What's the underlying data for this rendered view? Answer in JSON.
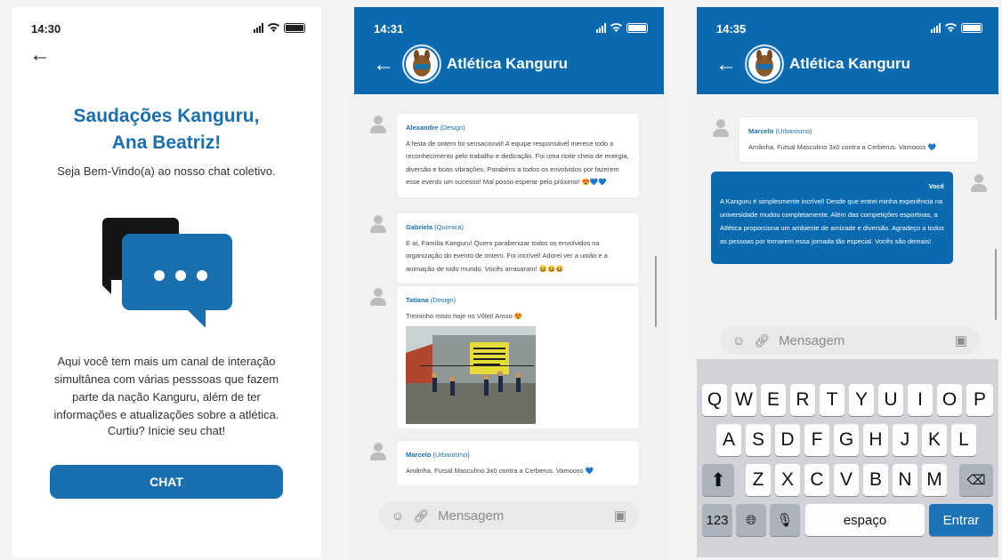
{
  "screen1": {
    "time": "14:30",
    "greeting_line1": "Saudações Kanguru,",
    "greeting_line2": "Ana Beatriz!",
    "welcome": "Seja Bem-Vindo(a) ao nosso chat coletivo.",
    "info": "Aqui você tem mais um canal de interação simultânea com várias pesssoas que fazem parte da nação Kanguru, além de ter informações e atualizações sobre a atlética.",
    "cta": "Curtiu? Inicie seu chat!",
    "chat_button": "CHAT"
  },
  "screen2": {
    "time": "14:31",
    "title": "Atlética Kanguru",
    "messages": [
      {
        "name": "Alexandre",
        "role": "(Design)",
        "text": "A festa de ontem foi sensacional! A equipe responsável merece todo o reconhecimento pelo trabalho e dedicação. Foi uma noite cheia de energia, diversão e boas vibrações. Parabéns a todos os envolvidos por fazerem esse evento um sucesso! Mal posso esperar pelo próximo! 😍💙💙"
      },
      {
        "name": "Gabriela",
        "role": "(Química)",
        "text": "E aí, Família Kanguru! Quero parabenizar todos os envolvidos na organização do evento de ontem. Foi incrível! Adorei ver a união e a animação de todo mundo. Vocês arrasaram! 😆😆😆"
      },
      {
        "name": "Tatiana",
        "role": "(Design)",
        "text": "Treininho misto hoje no Vôlei! Amoo 😍"
      },
      {
        "name": "Marcelo",
        "role": "(Urbanismo)",
        "text": "Amânha, Futsal Masculino 3x0 contra a Cerberus. Vamooss 💙"
      }
    ],
    "composer_placeholder": "Mensagem"
  },
  "screen3": {
    "time": "14:35",
    "title": "Atlética Kanguru",
    "message": {
      "name": "Marcelo",
      "role": "(Urbanismo)",
      "text": "Amânha, Futsal Masculino 3x0 contra a Cerberus. Vamooss 💙"
    },
    "mine": {
      "label": "Você",
      "text": "A Kanguru é simplesmente incrível! Desde que entrei minha experiência na universidade mudou completamente. Além das competições esportivas, a Atlética proporciona um ambiente de amizade e diversão. Agradeço a todos as pessoas por tornarem essa jornada tão especial. Vocês são demais!"
    },
    "composer_placeholder": "Mensagem",
    "keyboard": {
      "row1": [
        "Q",
        "W",
        "E",
        "R",
        "T",
        "Y",
        "U",
        "I",
        "O",
        "P"
      ],
      "row2": [
        "A",
        "S",
        "D",
        "F",
        "G",
        "H",
        "J",
        "K",
        "L"
      ],
      "row3": [
        "Z",
        "X",
        "C",
        "V",
        "B",
        "N",
        "M"
      ],
      "num": "123",
      "space": "espaço",
      "enter": "Entrar"
    }
  },
  "colors": {
    "primary": "#0a6ab0",
    "text_blue": "#1a6fb0"
  },
  "icons": [
    "back-arrow-icon",
    "signal-icon",
    "wifi-icon",
    "battery-icon",
    "chat-bubbles-icon",
    "avatar-icon",
    "emoji-icon",
    "attach-icon",
    "camera-icon",
    "shift-icon",
    "backspace-icon",
    "globe-icon",
    "mic-icon"
  ]
}
